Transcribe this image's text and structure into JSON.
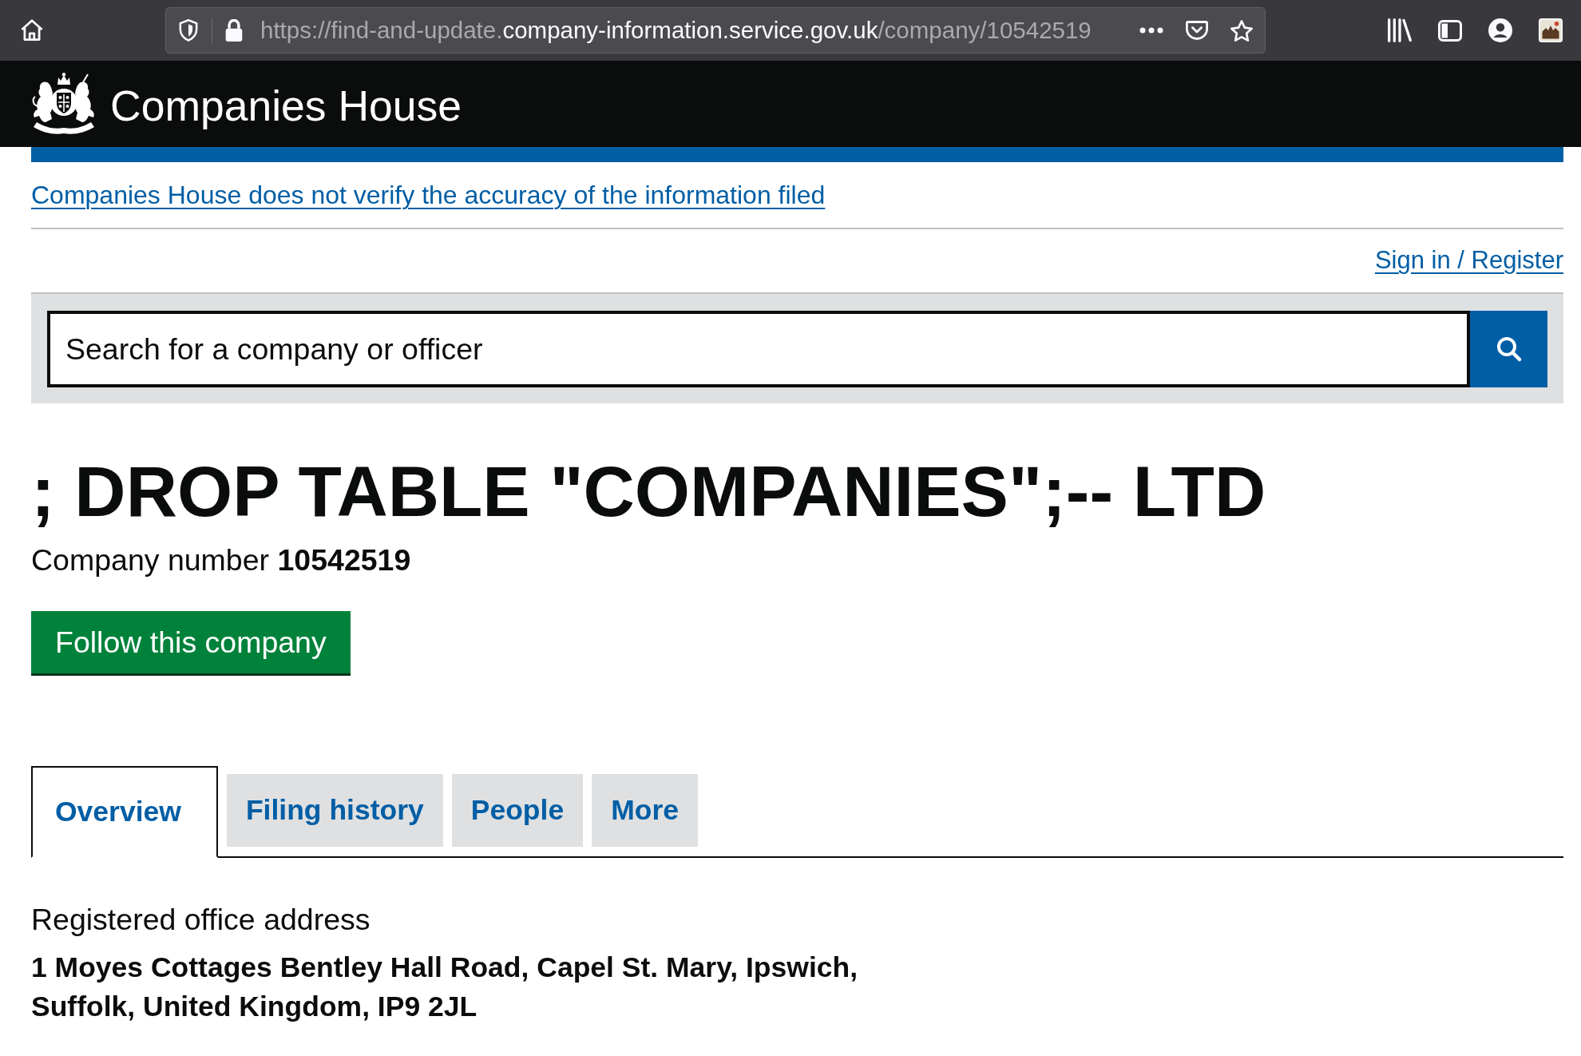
{
  "browser": {
    "url": {
      "prefix": "https://find-and-update.",
      "domain": "company-information.service.gov.uk",
      "path": "/company/10542519"
    }
  },
  "header": {
    "title": "Companies House"
  },
  "notice": {
    "disclaimer": "Companies House does not verify the accuracy of the information filed",
    "account_link": "Sign in / Register"
  },
  "search": {
    "placeholder": "Search for a company or officer"
  },
  "company": {
    "name": "; DROP TABLE \"COMPANIES\";-- LTD",
    "number_line": "Company number **10542519**",
    "follow_button": "Follow this company"
  },
  "tabs": [
    {
      "label": "Overview",
      "selected": true
    },
    {
      "label": "Filing history",
      "selected": false
    },
    {
      "label": "People",
      "selected": false
    },
    {
      "label": "More",
      "selected": false
    }
  ],
  "registered_office": {
    "label": "Registered office address",
    "address": "1 Moyes Cottages Bentley Hall Road, Capel St. Mary, Ipswich, Suffolk, United Kingdom, IP9 2JL"
  }
}
